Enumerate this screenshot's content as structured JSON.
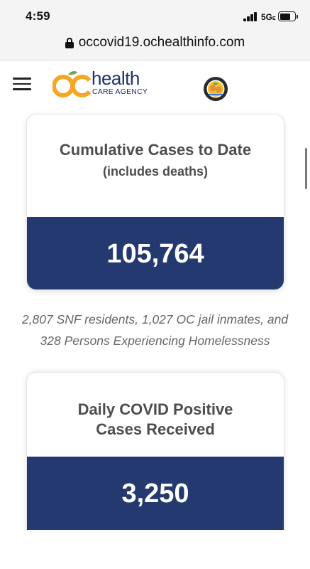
{
  "status_bar": {
    "time": "4:59",
    "network": "5G",
    "network_suffix": "E"
  },
  "browser": {
    "url": "occovid19.ochealthinfo.com"
  },
  "header": {
    "logo_mark": "OC",
    "logo_word": "health",
    "logo_sub": "CARE AGENCY",
    "menu_icon": "hamburger-icon",
    "seal_icon": "county-seal-icon"
  },
  "cards": [
    {
      "title": "Cumulative Cases to Date",
      "subtitle": "(includes deaths)",
      "value": "105,764",
      "note": "2,807 SNF residents, 1,027 OC jail inmates, and 328 Persons Experiencing Homelessness"
    },
    {
      "title": "Daily COVID Positive Cases Received",
      "value": "3,250"
    }
  ],
  "colors": {
    "band": "#24396f",
    "brand_navy": "#1e2f6e",
    "brand_orange": "#f5a623",
    "brand_green": "#6aa84f"
  }
}
